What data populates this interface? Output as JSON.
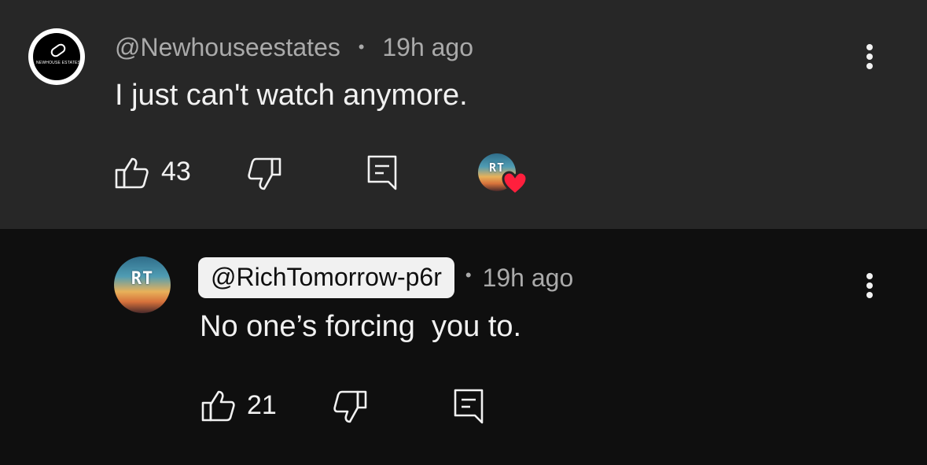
{
  "comments": [
    {
      "handle": "@Newhouseestates",
      "avatar_text": "NEWHOUSE ESTATES",
      "separator": "•",
      "time": "19h ago",
      "text": "I just can't watch anymore.",
      "likes": "43",
      "creator_heart": true,
      "creator_avatar_text": "RT"
    },
    {
      "handle": "@RichTomorrow-p6r",
      "handle_highlighted": true,
      "avatar_text": "RT",
      "separator": "•",
      "time": "19h ago",
      "text": "No one’s forcing  you to.",
      "likes": "21"
    }
  ],
  "colors": {
    "top_comment_bg": "#272727",
    "page_bg": "#0f0f0f",
    "heart": "#ff1f3d"
  },
  "icons": [
    "thumbs-up-icon",
    "thumbs-down-icon",
    "reply-icon",
    "more-vertical-icon",
    "heart-icon"
  ]
}
